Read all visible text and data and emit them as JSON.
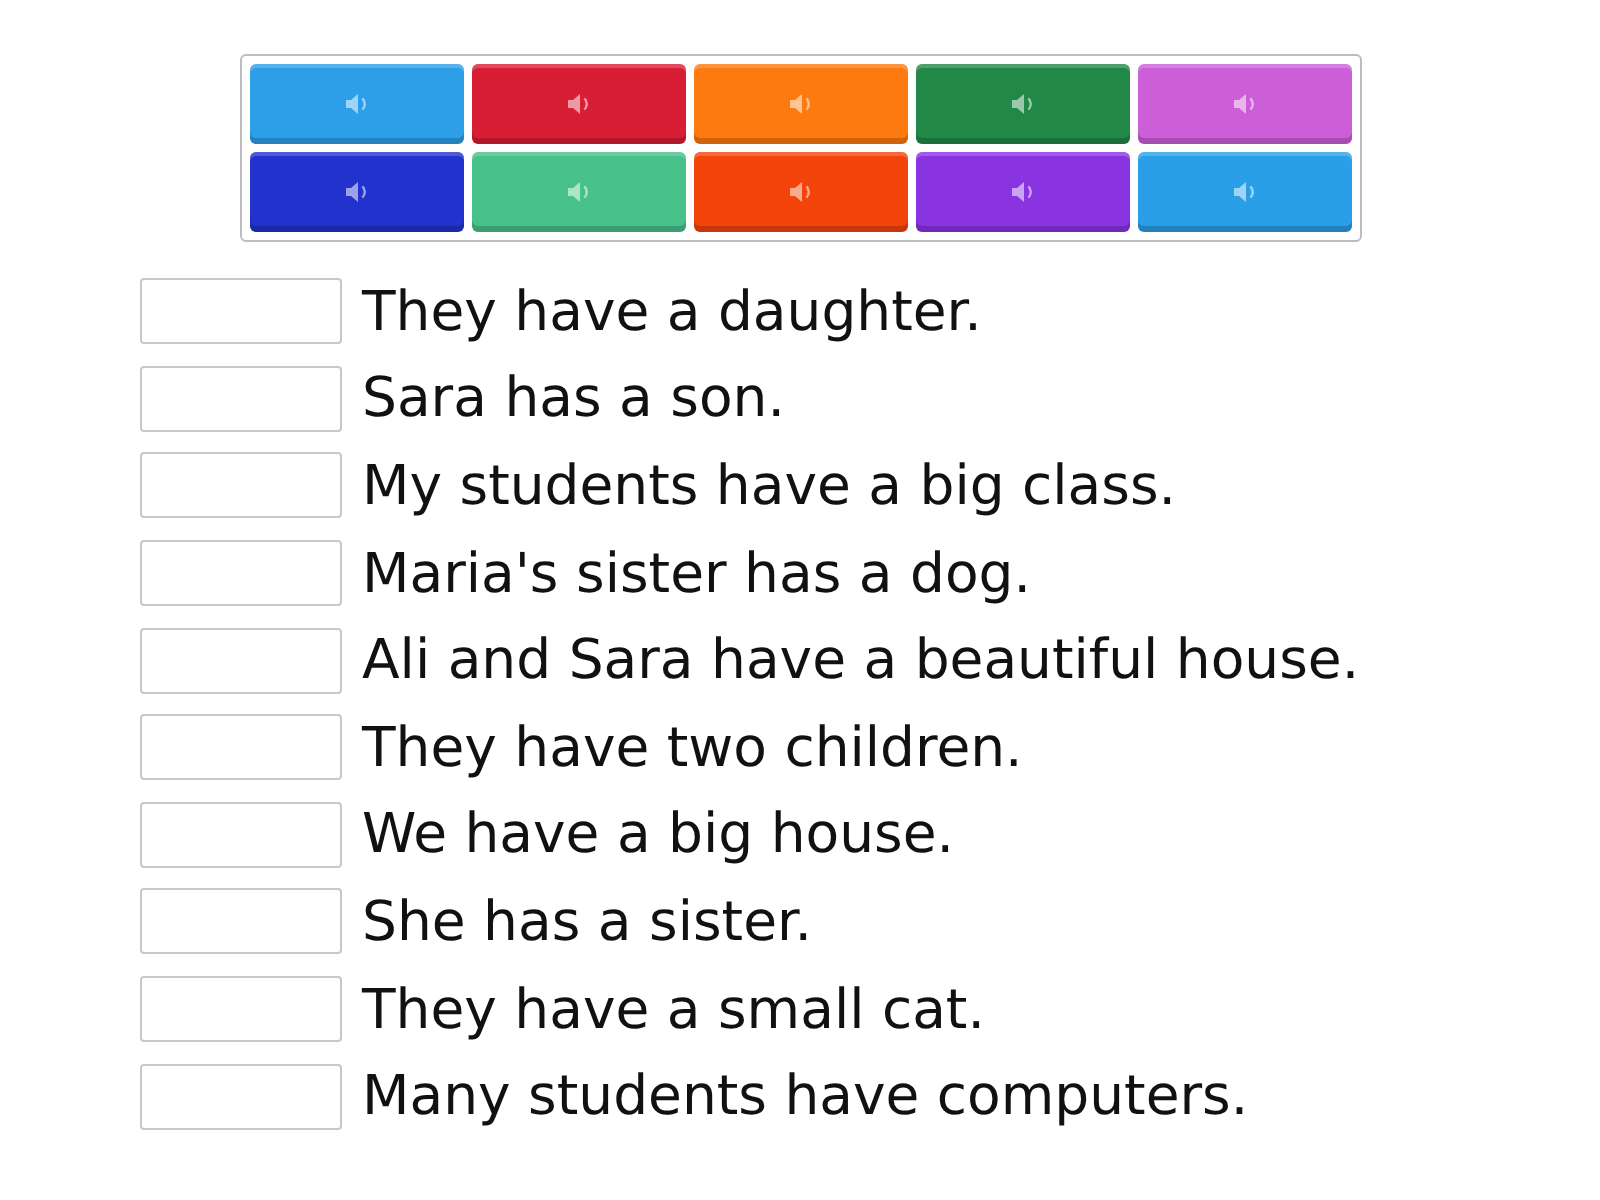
{
  "tiles": [
    {
      "color": "#2d9fe8"
    },
    {
      "color": "#d81e34"
    },
    {
      "color": "#fd7a10"
    },
    {
      "color": "#218848"
    },
    {
      "color": "#cc5ed8"
    },
    {
      "color": "#2232cc"
    },
    {
      "color": "#48c08a"
    },
    {
      "color": "#f3440c"
    },
    {
      "color": "#8a33e0"
    },
    {
      "color": "#2a9fe8"
    }
  ],
  "sentences": [
    {
      "text": "They have a daughter."
    },
    {
      "text": "Sara has a son."
    },
    {
      "text": "My students have a big class."
    },
    {
      "text": "Maria's sister has a dog."
    },
    {
      "text": "Ali and Sara have a beautiful house."
    },
    {
      "text": "They have two children."
    },
    {
      "text": "We have a big house."
    },
    {
      "text": "She has a sister."
    },
    {
      "text": "They have a small cat."
    },
    {
      "text": "Many students have computers."
    }
  ]
}
